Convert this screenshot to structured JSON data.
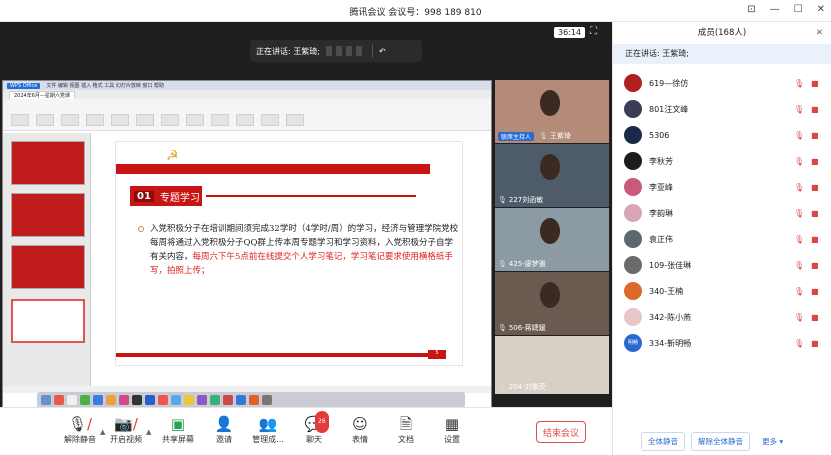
{
  "window": {
    "title": "腾讯会议 会议号：998 189 810"
  },
  "stage": {
    "speaking_label": "正在讲话: 王紫琦;",
    "timer": "36:14",
    "shared_screen": {
      "app_name": "WPS Office",
      "tab_title": "2024年6月—星期六党课",
      "slide": {
        "banner_number": "01",
        "banner_title": "专题学习",
        "body_normal": "入党积极分子在培训期间须完成32学时（4学时/周）的学习，经济与管理学院党校每周将通过入党积极分子QQ群上传本周专题学习和学习资料，入党积极分子自学有关内容，",
        "body_highlight": "每周六下午5点前在线提交个人学习笔记，学习笔记要求使用横格纸手写，拍照上传；",
        "page": "5"
      }
    },
    "videos": [
      {
        "name": "王紫琦",
        "host_badge": "联席主持人",
        "bg": "#b48a78"
      },
      {
        "name": "227刘函敏",
        "bg": "#4e5b6a"
      },
      {
        "name": "425-廖梦雅",
        "bg": "#8c9aa3"
      },
      {
        "name": "506-蒋婕媛",
        "bg": "#6b5a4f"
      },
      {
        "name": "204-刘紫荧",
        "bg": "#d8d0c6"
      }
    ]
  },
  "toolbar": {
    "unmute": "解除静音",
    "video": "开启视频",
    "share": "共享屏幕",
    "invite": "邀请",
    "manage": "管理成...",
    "chat": "聊天",
    "chat_badge": "26",
    "reactions": "表情",
    "docs": "文档",
    "settings": "设置",
    "end": "结束会议"
  },
  "panel": {
    "title": "成员(168人)",
    "speaking": "正在讲话: 王紫琦;",
    "members": [
      {
        "name": "619—徐仿",
        "color": "#b02020"
      },
      {
        "name": "801汪文峰",
        "color": "#3b3b5a"
      },
      {
        "name": "5306",
        "color": "#1a2a4a"
      },
      {
        "name": "李秋芳",
        "color": "#1d1d1d"
      },
      {
        "name": "李亚峰",
        "color": "#c85a7a"
      },
      {
        "name": "李韵琳",
        "color": "#d8a6b6"
      },
      {
        "name": "袁正伟",
        "color": "#5a6a6a"
      },
      {
        "name": "109-张佳琳",
        "color": "#6a6a6a"
      },
      {
        "name": "340-王楠",
        "color": "#d96a2a"
      },
      {
        "name": "342-陈小燕",
        "color": "#e6c6c6"
      },
      {
        "name": "334-靳明畅",
        "avatar_text": "明畅",
        "color": "#2a6ad0"
      }
    ],
    "mute_all": "全体静音",
    "unmute_all": "解除全体静音",
    "more": "更多"
  }
}
